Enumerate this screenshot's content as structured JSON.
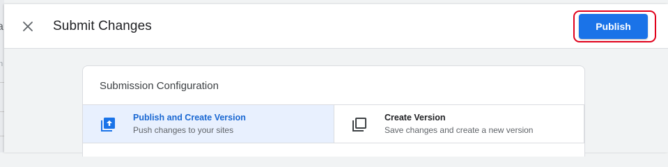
{
  "header": {
    "title": "Submit Changes",
    "close_icon": "close-icon",
    "publish_label": "Publish"
  },
  "background_page": {
    "edge_char": "a",
    "edge_char2": "n"
  },
  "config_card": {
    "title": "Submission Configuration",
    "options": [
      {
        "label": "Publish and Create Version",
        "description": "Push changes to your sites",
        "icon": "publish-version-icon",
        "selected": true
      },
      {
        "label": "Create Version",
        "description": "Save changes and create a new version",
        "icon": "copy-version-icon",
        "selected": false
      }
    ]
  },
  "colors": {
    "accent": "#1a73e8",
    "selected_bg": "#e8f0fe",
    "highlight_outline": "#e0001b"
  }
}
